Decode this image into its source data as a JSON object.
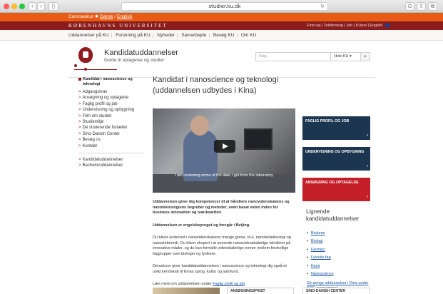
{
  "browser": {
    "url": "studier.ku.dk",
    "back_glyph": "‹",
    "forward_glyph": "›",
    "sidebar_glyph": "▯",
    "reload_glyph": "↻",
    "download_glyph": "⊙",
    "share_glyph": "⇪",
    "tabs_glyph": "⧉"
  },
  "corona_bar": {
    "label": "Coronavirus",
    "sun_glyph": "✹",
    "danish_link": "Dansk",
    "english_link": "English"
  },
  "university_bar": {
    "name": "KØBENHAVNS UNIVERSITET",
    "util_links": "Find vej | Telefonbog | Job | KUnet | English"
  },
  "top_nav": {
    "items": [
      "Uddannelser på KU",
      "Forskning på KU",
      "Nyheder",
      "Samarbejde",
      "Besøg KU",
      "Om KU"
    ]
  },
  "header": {
    "title": "Kandidatuddannelser",
    "subtitle": "Guide til optagelse og studier",
    "search_placeholder": "Søg...",
    "search_scope": "Hele KU",
    "scope_arrow": "▾",
    "search_glyph": "⌕"
  },
  "left_nav": {
    "current": "Kandidat i nanoscience og teknologi",
    "chevron": ">",
    "items": [
      "Adgangskrav",
      "Ansøgning og optagelse",
      "Faglig profil og job",
      "Undervisning og opbygning",
      "Film om studiet",
      "Studiemiljø",
      "De studerende fortæller",
      "Sino-Danish Center",
      "Besøg os",
      "Kontakt"
    ],
    "secondary": [
      "Kandidatuddannelser",
      "Bacheloruddannelser"
    ]
  },
  "main": {
    "title": "Kandidat i nanoscience og teknologi (uddannelsen udbydes i Kina)",
    "video_caption": "I am reviewing some of the data I got from the laboratory",
    "p1": "Uddannelsen giver dig kompetencer til at håndtere nanovidenskabens og nanoteknologiens begreber og metoder, samt basal viden inden for business innovation og iværksætteri.",
    "p2": "Uddannelsen er engelsksproget og foregår i Beijing.",
    "p3": "Du bliver undervist i nanovidenskabens mange grene, bl.a. nanobioteknologi og nanoelektronik. Du bliver ekspert i at anvende naturvidenskabelige teknikker på innovative måder, og du kan formidle videnskabelige emner mellem forskellige faggrupper som biologer og fysikere.",
    "p4": "Derudover giver kandidatuddannelsen i nanoscience og teknologi dig også et unikt kendskab til Kinas sprog, kultur og samfund.",
    "p5_prefix": "Læs mere om uddannelsen under",
    "p5_link": "Faglig profil og job"
  },
  "right": {
    "tiles": [
      "FAGLIG PROFIL OG JOB",
      "UNDERVISNING OG OPBYGNING",
      "ANSØGNING OG OPTAGELSE"
    ],
    "tile_arrow": "›",
    "related_title": "Lignende kandidatuddannelser",
    "related": [
      "Biokemi",
      "Biologi",
      "Farmaci",
      "Fysiske fag",
      "Kemi",
      "Nanoscience"
    ],
    "more_link": "De øvrige uddannelser i Kina under SDC-programmet"
  },
  "bottom": {
    "box1": "ANSØGNINGSFRIST",
    "box2": "SINO-DANISH CENTER"
  },
  "colors": {
    "corona_bar": "#e85b14",
    "university_red": "#901a1e",
    "tile_blue": "#1c3550",
    "tile_red": "#c41f28",
    "link_blue": "#1a55a0"
  }
}
